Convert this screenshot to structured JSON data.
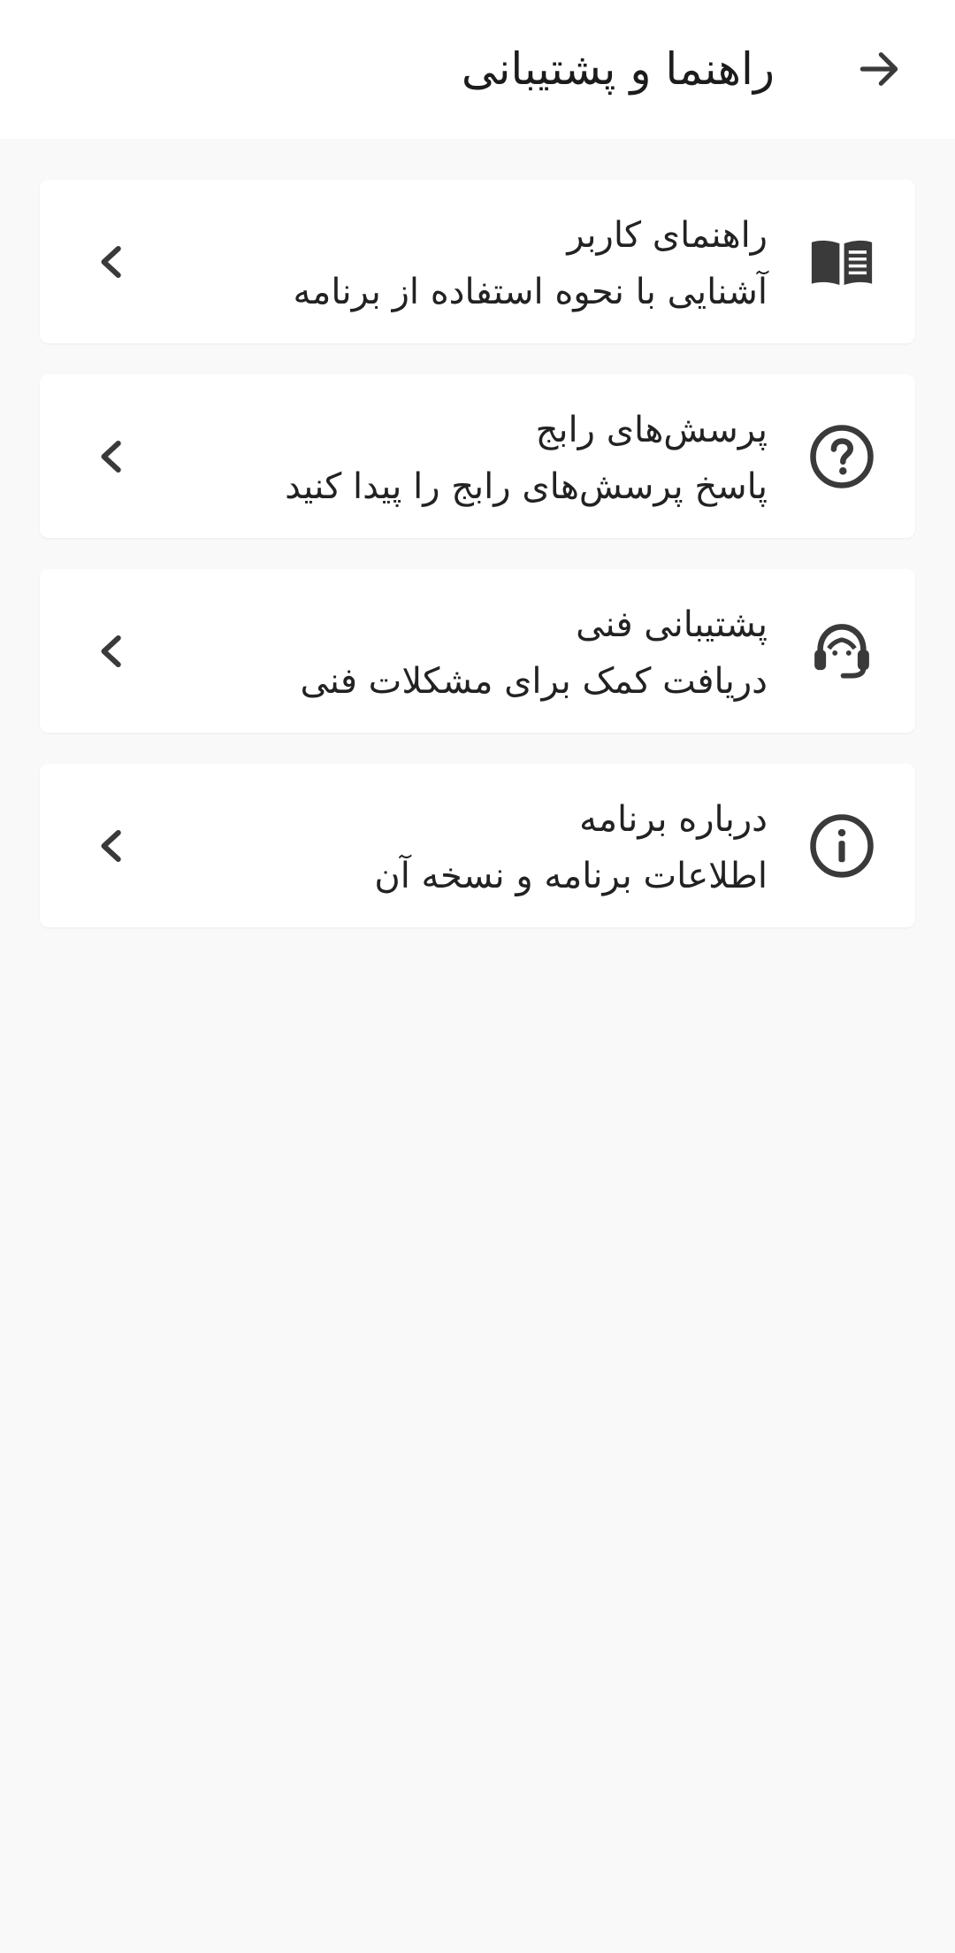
{
  "header": {
    "title": "راهنما و پشتیبانی",
    "back_icon": "arrow-right-icon"
  },
  "menu": {
    "items": [
      {
        "title": "راهنمای کاربر",
        "subtitle": "آشنایی با نحوه استفاده از برنامه",
        "icon": "book-icon"
      },
      {
        "title": "پرسش‌های رابج",
        "subtitle": "پاسخ پرسش‌های رابج را پیدا کنید",
        "icon": "question-circle-icon"
      },
      {
        "title": "پشتیبانی فنی",
        "subtitle": "دریافت کمک برای مشکلات فنی",
        "icon": "support-agent-icon"
      },
      {
        "title": "درباره برنامه",
        "subtitle": "اطلاعات برنامه و نسخه آن",
        "icon": "info-circle-icon"
      }
    ],
    "chevron_icon": "chevron-left-icon"
  },
  "colors": {
    "background": "#f9f9f9",
    "surface": "#ffffff",
    "icon": "#3a3a3a",
    "text": "#222222"
  }
}
